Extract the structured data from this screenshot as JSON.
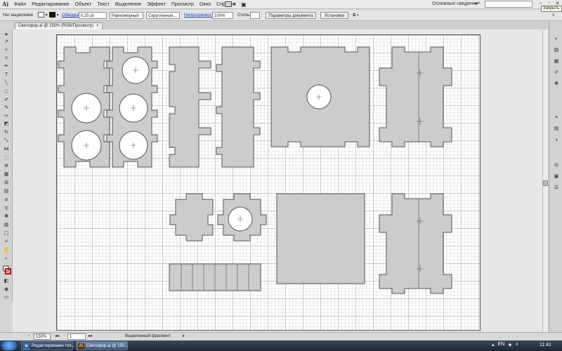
{
  "app": {
    "logo": "Ai"
  },
  "menu": [
    "Файл",
    "Редактирование",
    "Объект",
    "Текст",
    "Выделение",
    "Эффект",
    "Просмотр",
    "Окно",
    "Справка"
  ],
  "workspace": {
    "label": "Основные сведения",
    "search_placeholder": ""
  },
  "tooltip": {
    "close": "Закрыть"
  },
  "controlbar": {
    "selection_state": "Нет выделения",
    "stroke_link": "Обводка",
    "stroke_weight": "0,25 pt",
    "stroke_profile": "Равномерный",
    "brush": "Скругленная...",
    "opacity_link": "Непрозрачность",
    "opacity_value": "100%",
    "styles_label": "Стиль:",
    "doc_setup_button": "Параметры документа",
    "prefs_button": "Установки"
  },
  "document": {
    "tab_title": "Светофор.ai @ 150% (RGB/Просмотр)",
    "close_symbol": "×"
  },
  "status": {
    "zoom": "150%",
    "artboard_number": "1",
    "tool_status": "Выделенный фрагмент"
  },
  "taskbar": {
    "tasks": [
      "Редактирование топ...",
      "Светофор.ai @ 150..."
    ],
    "clock": "11:41",
    "language": "EN"
  },
  "colors": {
    "piece_fill": "#cccccc",
    "piece_stroke": "#555555",
    "menu_bg": "#e9e9e9",
    "taskbar": "#1d2634"
  },
  "icons": {
    "tools": [
      "selection-tool",
      "direct-selection-tool",
      "magic-wand-tool",
      "lasso-tool",
      "pen-tool",
      "type-tool",
      "line-tool",
      "rectangle-tool",
      "paintbrush-tool",
      "pencil-tool",
      "blob-brush-tool",
      "eraser-tool",
      "rotate-tool",
      "scale-tool",
      "width-tool",
      "free-transform-tool",
      "shape-builder-tool",
      "perspective-grid-tool",
      "mesh-tool",
      "gradient-tool",
      "eyedropper-tool",
      "blend-tool",
      "symbol-sprayer-tool",
      "column-graph-tool",
      "artboard-tool",
      "slice-tool",
      "hand-tool",
      "zoom-tool",
      "fill-stroke-swatch",
      "drawing-mode",
      "screen-mode"
    ]
  }
}
